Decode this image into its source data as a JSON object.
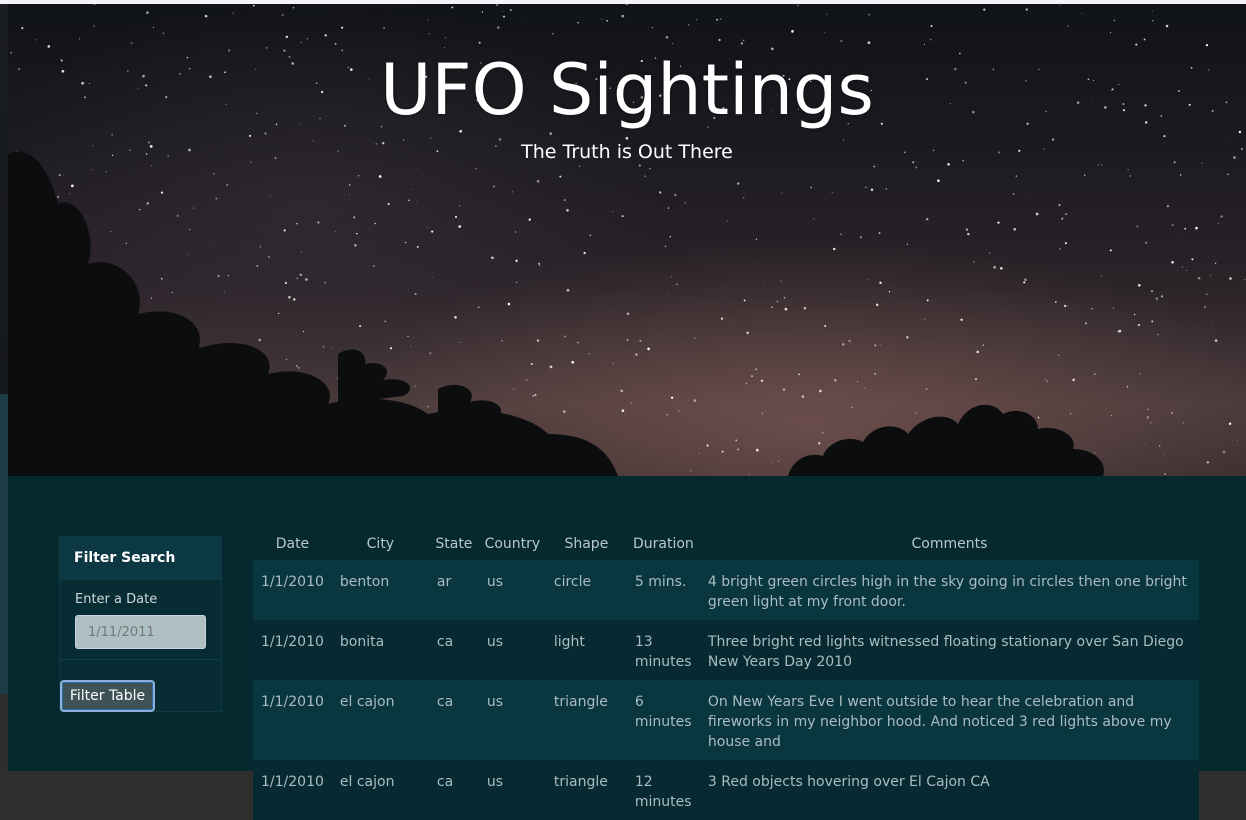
{
  "hero": {
    "title": "UFO Sightings",
    "subtitle": "The Truth is Out There"
  },
  "filter": {
    "heading": "Filter Search",
    "date_label": "Enter a Date",
    "date_placeholder": "1/11/2011",
    "button_label": "Filter Table"
  },
  "table": {
    "headers": [
      "Date",
      "City",
      "State",
      "Country",
      "Shape",
      "Duration",
      "Comments"
    ],
    "rows": [
      {
        "date": "1/1/2010",
        "city": "benton",
        "state": "ar",
        "country": "us",
        "shape": "circle",
        "duration": "5 mins.",
        "comments": "4 bright green circles high in the sky going in circles then one bright green light at my front door."
      },
      {
        "date": "1/1/2010",
        "city": "bonita",
        "state": "ca",
        "country": "us",
        "shape": "light",
        "duration": "13 minutes",
        "comments": "Three bright red lights witnessed floating stationary over San Diego New Years Day 2010"
      },
      {
        "date": "1/1/2010",
        "city": "el cajon",
        "state": "ca",
        "country": "us",
        "shape": "triangle",
        "duration": "6 minutes",
        "comments": "On New Years Eve I went outside to hear the celebration and fireworks in my neighbor hood. And noticed 3 red lights above my house and"
      },
      {
        "date": "1/1/2010",
        "city": "el cajon",
        "state": "ca",
        "country": "us",
        "shape": "triangle",
        "duration": "12 minutes",
        "comments": "3 Red objects hovering over El Cajon CA"
      }
    ]
  },
  "colors": {
    "main_background": "#06282f",
    "panel_background": "#072c34",
    "row_alt": "#0a3640"
  }
}
